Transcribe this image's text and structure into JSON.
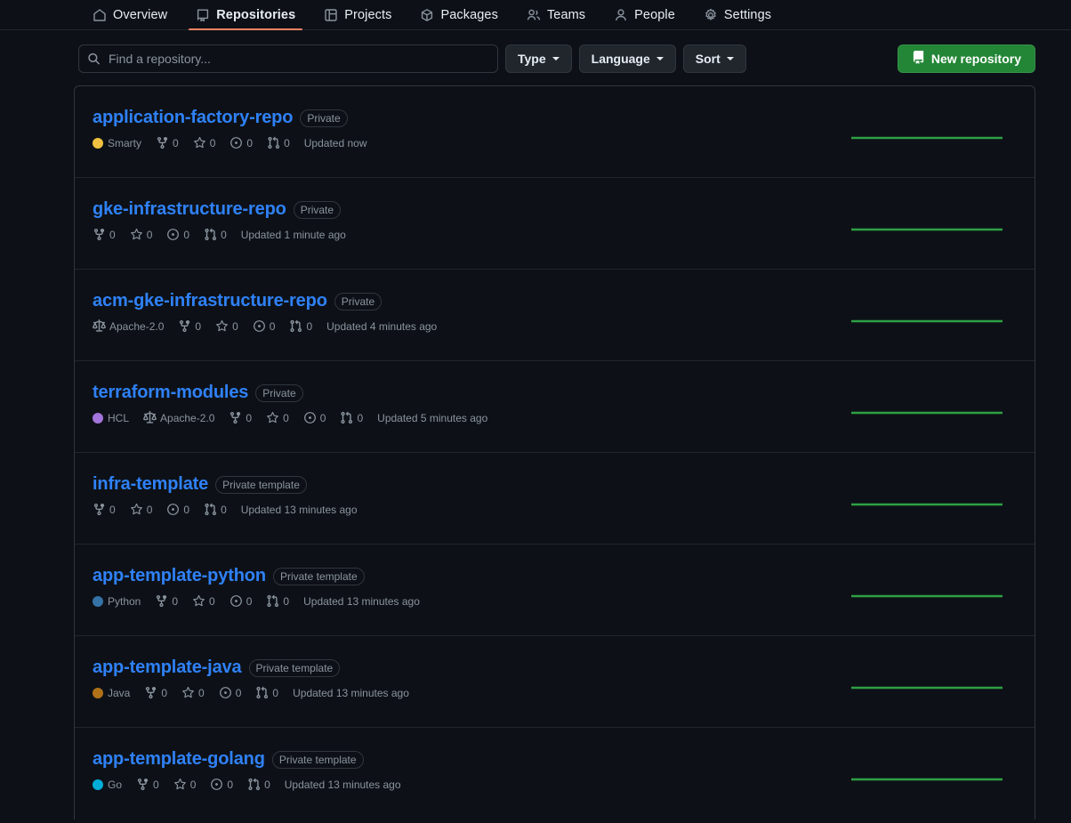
{
  "nav": {
    "items": [
      {
        "label": "Overview",
        "icon": "home-icon",
        "active": false
      },
      {
        "label": "Repositories",
        "icon": "repo-icon",
        "active": true
      },
      {
        "label": "Projects",
        "icon": "project-icon",
        "active": false
      },
      {
        "label": "Packages",
        "icon": "package-icon",
        "active": false
      },
      {
        "label": "Teams",
        "icon": "people-icon",
        "active": false
      },
      {
        "label": "People",
        "icon": "person-icon",
        "active": false
      },
      {
        "label": "Settings",
        "icon": "gear-icon",
        "active": false
      }
    ],
    "active_underline_color": "#f78166"
  },
  "filters": {
    "search_placeholder": "Find a repository...",
    "search_value": "",
    "type_label": "Type",
    "language_label": "Language",
    "sort_label": "Sort",
    "new_repository_label": "New repository",
    "new_repository_color": "#238636"
  },
  "colors": {
    "background": "#0d1117",
    "border": "#30363d",
    "divider": "#21262d",
    "link": "#2f81f7",
    "muted": "#8b949e",
    "sparkline": "#2ea043"
  },
  "repositories": [
    {
      "name": "application-factory-repo",
      "visibility": "Private",
      "language": "Smarty",
      "language_color": "#f0c040",
      "license": "",
      "forks": "0",
      "stars": "0",
      "issues": "0",
      "pulls": "0",
      "updated": "Updated now"
    },
    {
      "name": "gke-infrastructure-repo",
      "visibility": "Private",
      "language": "",
      "language_color": "",
      "license": "",
      "forks": "0",
      "stars": "0",
      "issues": "0",
      "pulls": "0",
      "updated": "Updated 1 minute ago"
    },
    {
      "name": "acm-gke-infrastructure-repo",
      "visibility": "Private",
      "language": "",
      "language_color": "",
      "license": "Apache-2.0",
      "forks": "0",
      "stars": "0",
      "issues": "0",
      "pulls": "0",
      "updated": "Updated 4 minutes ago"
    },
    {
      "name": "terraform-modules",
      "visibility": "Private",
      "language": "HCL",
      "language_color": "#a374db",
      "license": "Apache-2.0",
      "forks": "0",
      "stars": "0",
      "issues": "0",
      "pulls": "0",
      "updated": "Updated 5 minutes ago"
    },
    {
      "name": "infra-template",
      "visibility": "Private template",
      "language": "",
      "language_color": "",
      "license": "",
      "forks": "0",
      "stars": "0",
      "issues": "0",
      "pulls": "0",
      "updated": "Updated 13 minutes ago"
    },
    {
      "name": "app-template-python",
      "visibility": "Private template",
      "language": "Python",
      "language_color": "#3572A5",
      "license": "",
      "forks": "0",
      "stars": "0",
      "issues": "0",
      "pulls": "0",
      "updated": "Updated 13 minutes ago"
    },
    {
      "name": "app-template-java",
      "visibility": "Private template",
      "language": "Java",
      "language_color": "#b07219",
      "license": "",
      "forks": "0",
      "stars": "0",
      "issues": "0",
      "pulls": "0",
      "updated": "Updated 13 minutes ago"
    },
    {
      "name": "app-template-golang",
      "visibility": "Private template",
      "language": "Go",
      "language_color": "#00ADD8",
      "license": "",
      "forks": "0",
      "stars": "0",
      "issues": "0",
      "pulls": "0",
      "updated": "Updated 13 minutes ago"
    }
  ]
}
